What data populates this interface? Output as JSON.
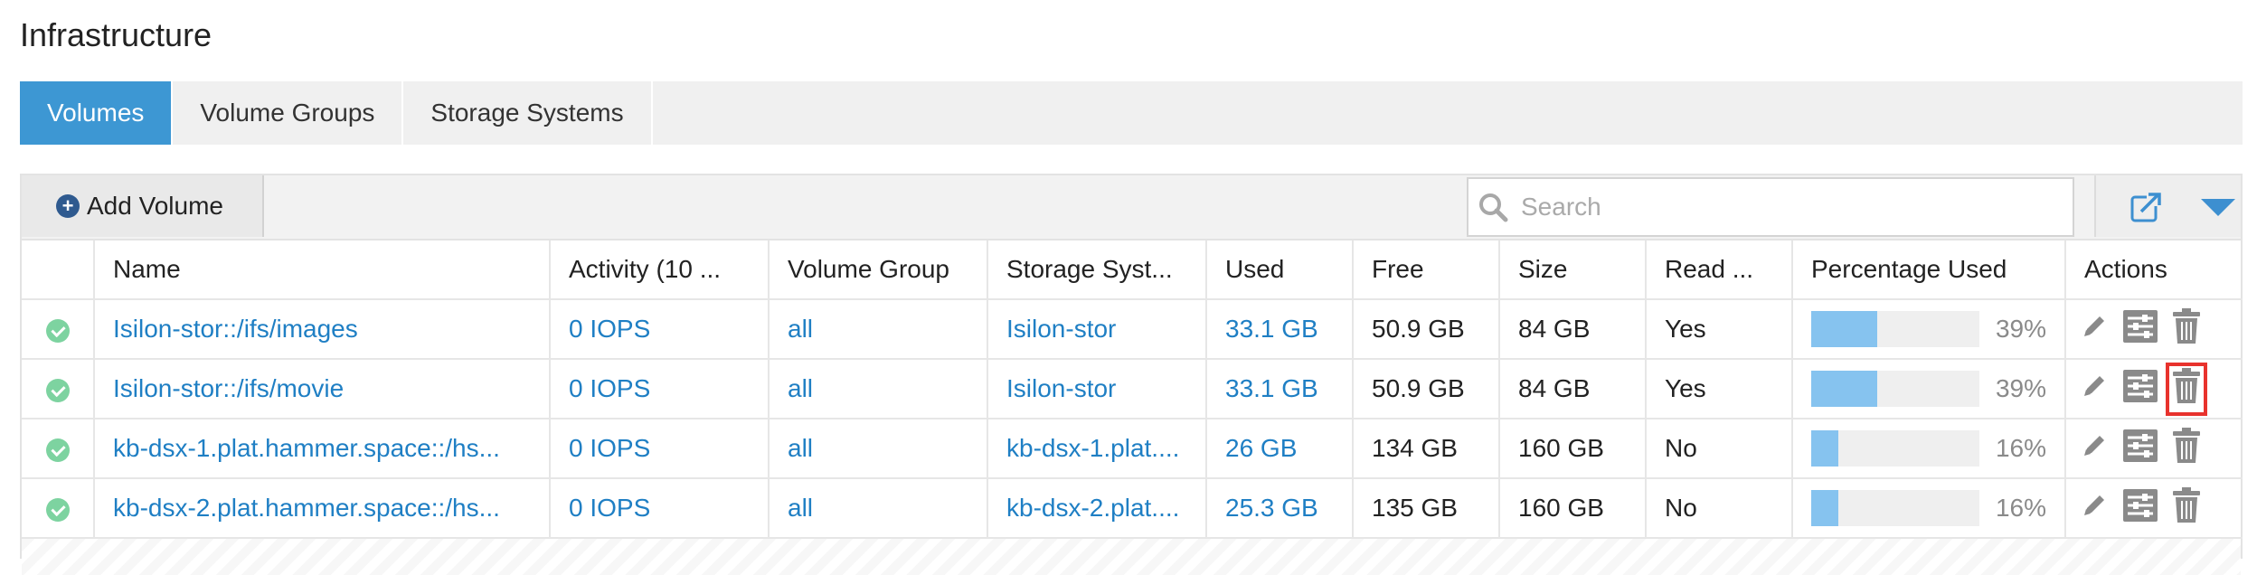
{
  "page": {
    "title": "Infrastructure"
  },
  "tabs": [
    {
      "label": "Volumes",
      "active": true
    },
    {
      "label": "Volume Groups",
      "active": false
    },
    {
      "label": "Storage Systems",
      "active": false
    }
  ],
  "toolbar": {
    "add_label": "Add Volume",
    "search_placeholder": "Search",
    "icons": {
      "add": "plus-circle-icon",
      "search": "search-icon",
      "export": "export-icon",
      "menu": "chevron-down-icon"
    }
  },
  "colors": {
    "accent": "#3d97d3",
    "link": "#1f7fc4",
    "status_ok": "#7dd3a0",
    "bar_fill": "#86c3ef",
    "highlight": "#e8322d"
  },
  "table": {
    "columns": [
      "",
      "Name",
      "Activity (10 ...",
      "Volume Group",
      "Storage Syst...",
      "Used",
      "Free",
      "Size",
      "Read ...",
      "Percentage Used",
      "Actions"
    ],
    "rows": [
      {
        "status": "ok",
        "name": "Isilon-stor::/ifs/images",
        "activity": "0 IOPS",
        "group": "all",
        "system": "Isilon-stor",
        "used": "33.1 GB",
        "free": "50.9 GB",
        "size": "84 GB",
        "read": "Yes",
        "pct_value": 39,
        "pct": "39%"
      },
      {
        "status": "ok",
        "name": "Isilon-stor::/ifs/movie",
        "activity": "0 IOPS",
        "group": "all",
        "system": "Isilon-stor",
        "used": "33.1 GB",
        "free": "50.9 GB",
        "size": "84 GB",
        "read": "Yes",
        "pct_value": 39,
        "pct": "39%"
      },
      {
        "status": "ok",
        "name": "kb-dsx-1.plat.hammer.space::/hs...",
        "activity": "0 IOPS",
        "group": "all",
        "system": "kb-dsx-1.plat....",
        "used": "26 GB",
        "free": "134 GB",
        "size": "160 GB",
        "read": "No",
        "pct_value": 16,
        "pct": "16%"
      },
      {
        "status": "ok",
        "name": "kb-dsx-2.plat.hammer.space::/hs...",
        "activity": "0 IOPS",
        "group": "all",
        "system": "kb-dsx-2.plat....",
        "used": "25.3 GB",
        "free": "135 GB",
        "size": "160 GB",
        "read": "No",
        "pct_value": 16,
        "pct": "16%"
      }
    ]
  }
}
